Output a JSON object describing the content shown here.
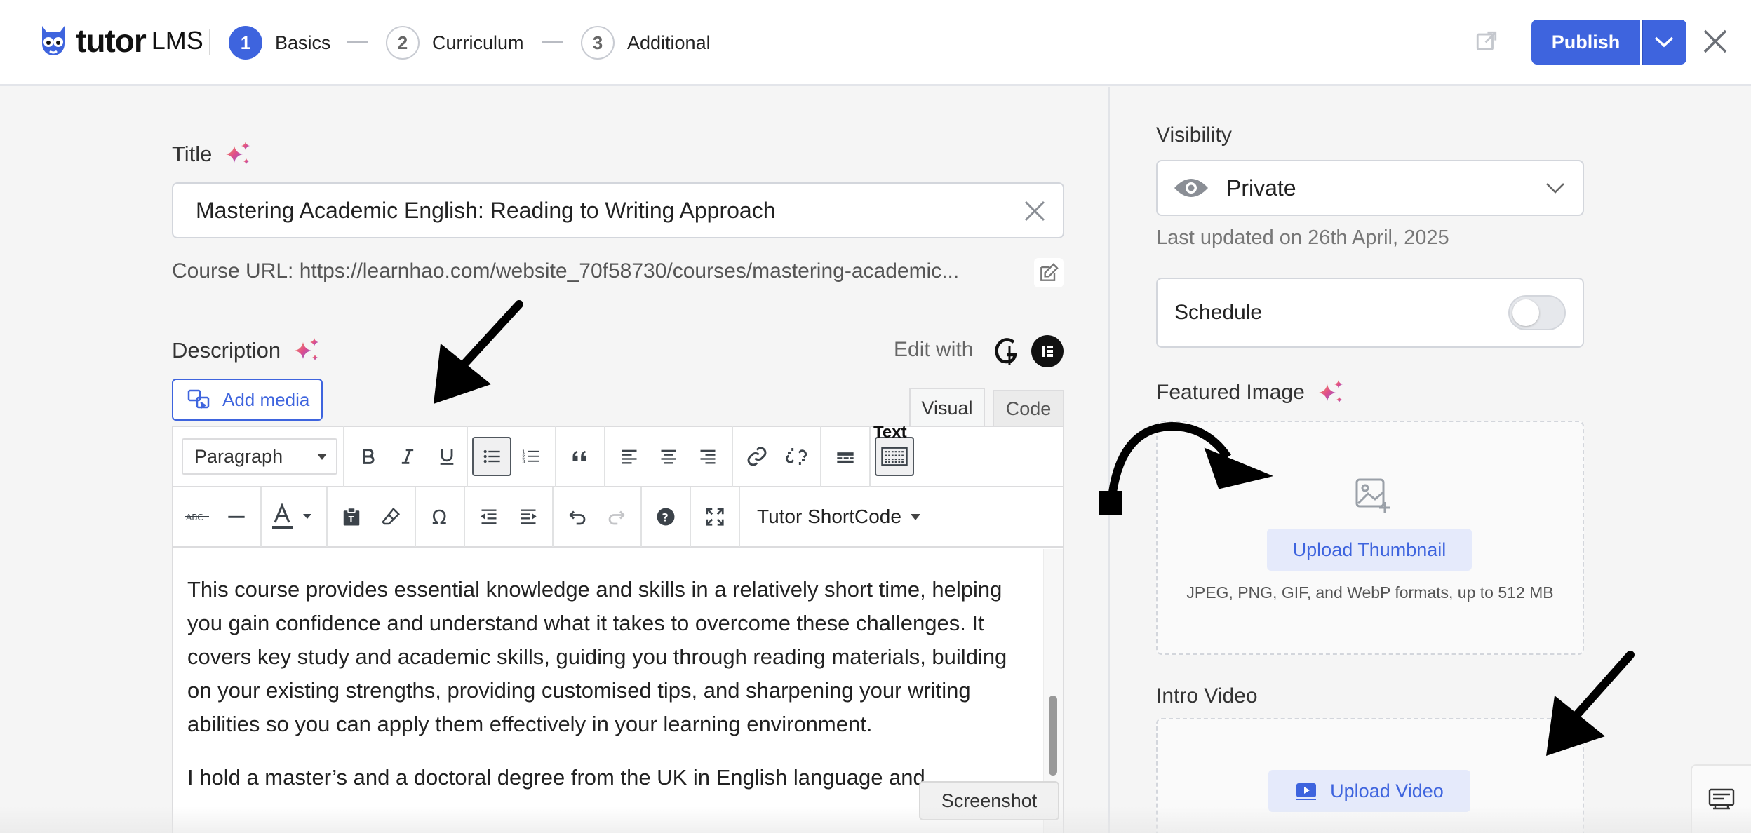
{
  "colors": {
    "accent": "#3e64de",
    "accent_light": "#e5eafb",
    "background": "#f5f5f5",
    "border": "#d3d6dc"
  },
  "header": {
    "brand": "tutor",
    "brand_suffix": "LMS",
    "steps": [
      {
        "number": "1",
        "label": "Basics",
        "active": true
      },
      {
        "number": "2",
        "label": "Curriculum",
        "active": false
      },
      {
        "number": "3",
        "label": "Additional",
        "active": false
      }
    ],
    "publish_label": "Publish",
    "icons": [
      "external-link-icon",
      "chevron-down-icon",
      "close-icon"
    ]
  },
  "main": {
    "title_label": "Title",
    "title_value": "Mastering Academic English: Reading to Writing Approach",
    "course_url": "Course URL: https://learnhao.com/website_70f58730/courses/mastering-academic...",
    "description_label": "Description",
    "edit_with_label": "Edit with",
    "add_media_label": "Add media",
    "tabs": {
      "visual": "Visual",
      "code": "Code"
    },
    "toolbar": {
      "paragraph_select": "Paragraph",
      "text_label": "Text",
      "shortcode_label": "Tutor ShortCode"
    },
    "body_paragraphs": [
      "This course provides essential knowledge and skills in a relatively short time, helping you gain confidence and understand what it takes to overcome these challenges. It covers key study and academic skills, guiding you through reading materials, building on your existing strengths, providing customised tips, and sharpening your writing abilities so you can apply them effectively in your learning environment.",
      "I hold a master’s and a doctoral degree from the UK in English language and"
    ],
    "tooltip": "Screenshot"
  },
  "sidebar": {
    "visibility_label": "Visibility",
    "visibility_value": "Private",
    "last_updated": "Last updated on 26th April, 2025",
    "schedule_label": "Schedule",
    "schedule_enabled": false,
    "featured_image_label": "Featured Image",
    "upload_thumbnail_label": "Upload Thumbnail",
    "formats_note": "JPEG, PNG, GIF, and WebP formats, up to 512 MB",
    "intro_video_label": "Intro Video",
    "upload_video_label": "Upload Video"
  }
}
